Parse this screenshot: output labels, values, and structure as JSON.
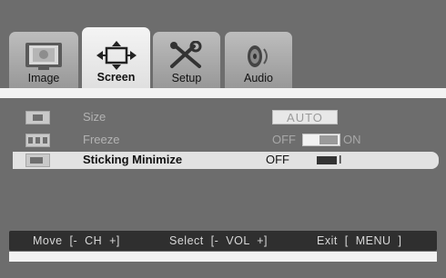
{
  "tabs": [
    {
      "label": "Image",
      "icon": "monitor-icon",
      "active": false
    },
    {
      "label": "Screen",
      "icon": "screen-arrows-icon",
      "active": true
    },
    {
      "label": "Setup",
      "icon": "tools-icon",
      "active": false
    },
    {
      "label": "Audio",
      "icon": "speaker-icon",
      "active": false
    }
  ],
  "menu": {
    "rows": [
      {
        "label": "Size",
        "icon": "size-icon",
        "value": "AUTO",
        "enabled": false,
        "selected": false
      },
      {
        "label": "Freeze",
        "icon": "freeze-icon",
        "off_label": "OFF",
        "on_label": "ON",
        "state": "on",
        "enabled": false,
        "selected": false
      },
      {
        "label": "Sticking Minimize",
        "icon": "sticking-minimize-icon",
        "off_label": "OFF",
        "on_label": "I",
        "state": "on",
        "enabled": true,
        "selected": true
      }
    ]
  },
  "hints": {
    "move": "Move  [-  CH  +]",
    "select": "Select  [-  VOL  +]",
    "exit": "Exit  [  MENU  ]"
  },
  "colors": {
    "background": "#6d6d6d",
    "active_tab": "#eeeeee",
    "inactive_tab": "#aaaaaa",
    "highlight_row": "#e2e2e2",
    "hint_bar": "#2f2f2f"
  }
}
